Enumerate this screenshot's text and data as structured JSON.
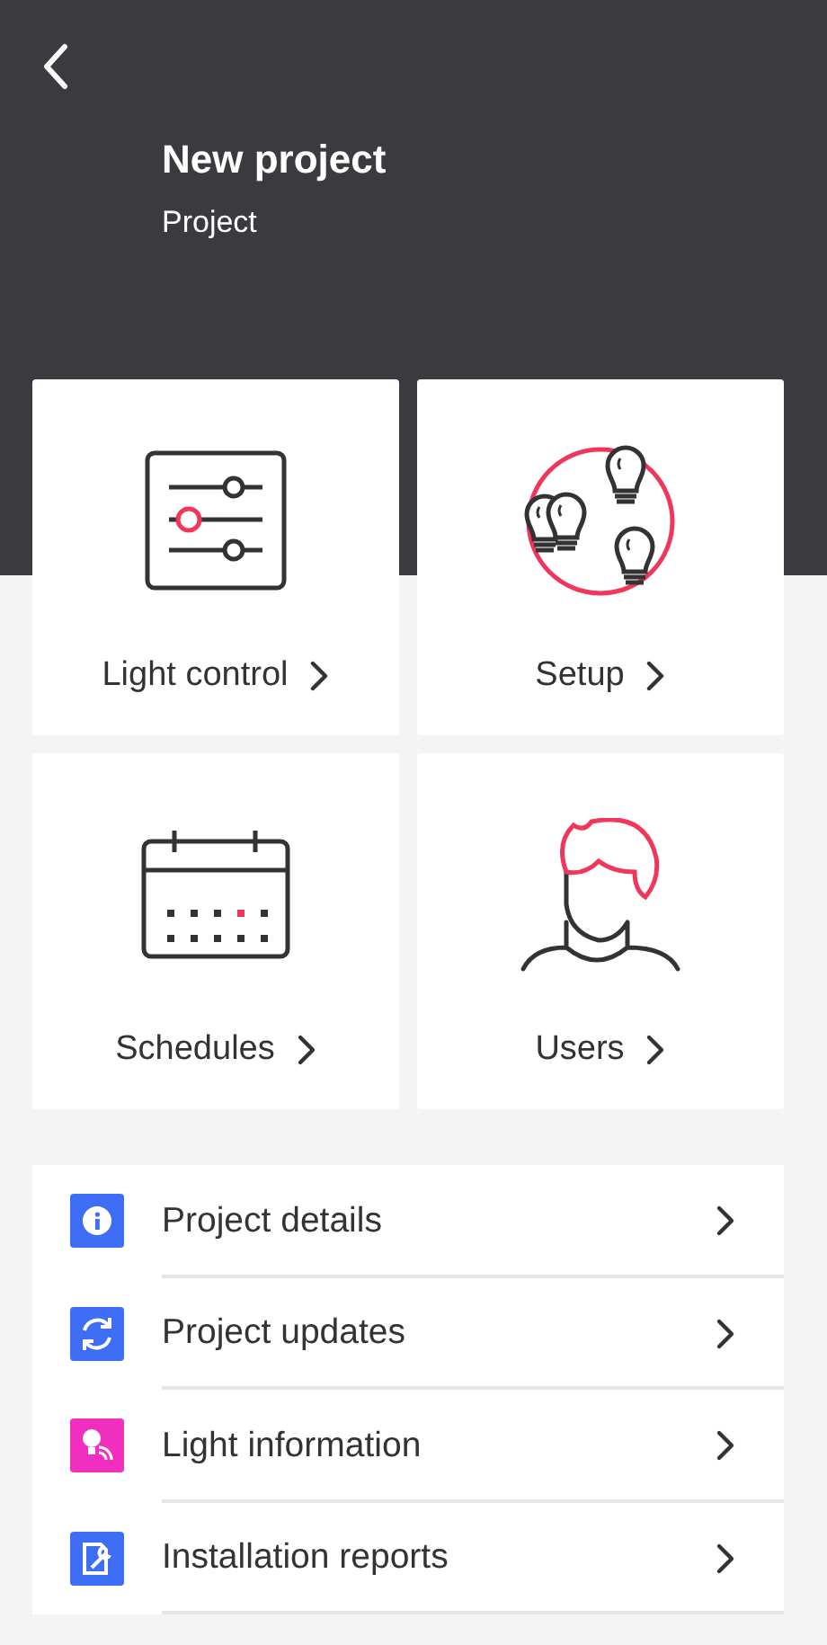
{
  "header": {
    "title": "New project",
    "subtitle": "Project"
  },
  "tiles": [
    {
      "kind": "sliders",
      "label": "Light control"
    },
    {
      "kind": "bulbs",
      "label": "Setup"
    },
    {
      "kind": "calendar",
      "label": "Schedules"
    },
    {
      "kind": "user",
      "label": "Users"
    }
  ],
  "list": [
    {
      "kind": "info",
      "label": "Project details",
      "color": "#3d6ef5"
    },
    {
      "kind": "sync",
      "label": "Project updates",
      "color": "#3d6ef5"
    },
    {
      "kind": "light",
      "label": "Light information",
      "color": "#f02ec0"
    },
    {
      "kind": "report",
      "label": "Installation reports",
      "color": "#3d6ef5"
    }
  ]
}
